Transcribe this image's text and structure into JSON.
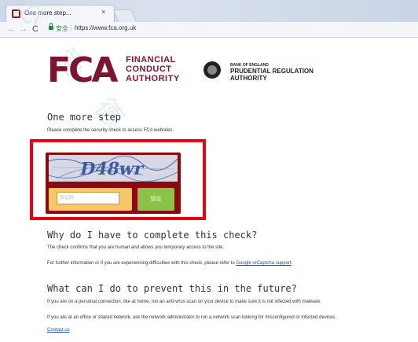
{
  "browser": {
    "tab_title": "One more step...",
    "tab_close": "×",
    "nav_back": "←",
    "nav_forward": "→",
    "nav_reload": "C",
    "secure_label": "安全",
    "url_separator": "|",
    "url": "https://www.fca.org.uk"
  },
  "watermark": "必 爱 德",
  "logo": {
    "fca_letters": "FCA",
    "fca_line1": "FINANCIAL",
    "fca_line2": "CONDUCT",
    "fca_line3": "AUTHORITY",
    "boe_small": "BANK OF ENGLAND",
    "pra_line1": "PRUDENTIAL REGULATION",
    "pra_line2": "AUTHORITY"
  },
  "main": {
    "title": "One more step",
    "subtitle": "Please complete the security check to access FCA websites.",
    "captcha_text": "D48wr",
    "captcha_placeholder": "验证码",
    "verify_label": "验证",
    "why_title": "Why do I have to complete this check?",
    "why_text": "The check confirms that you are human and allows you temporary access to the site.",
    "info_text": "For further information or if you are experiencing difficulties with this check, please refer to ",
    "info_link": "Google reCaptcha support",
    "info_end": ".",
    "what_title": "What can I do to prevent this in the future?",
    "personal_text": "If you are on a personal connection, like at home, run an anti-virus scan on your device to make sure it is not infected with malware.",
    "office_text": "If you are at an office or shared network, ask the network administrator to run a network scan looking for misconfigured or infected devices.",
    "contact_link": "Contact us"
  },
  "colors": {
    "brand": "#7d1530",
    "highlight": "#e60012",
    "verify": "#8bc34a"
  }
}
